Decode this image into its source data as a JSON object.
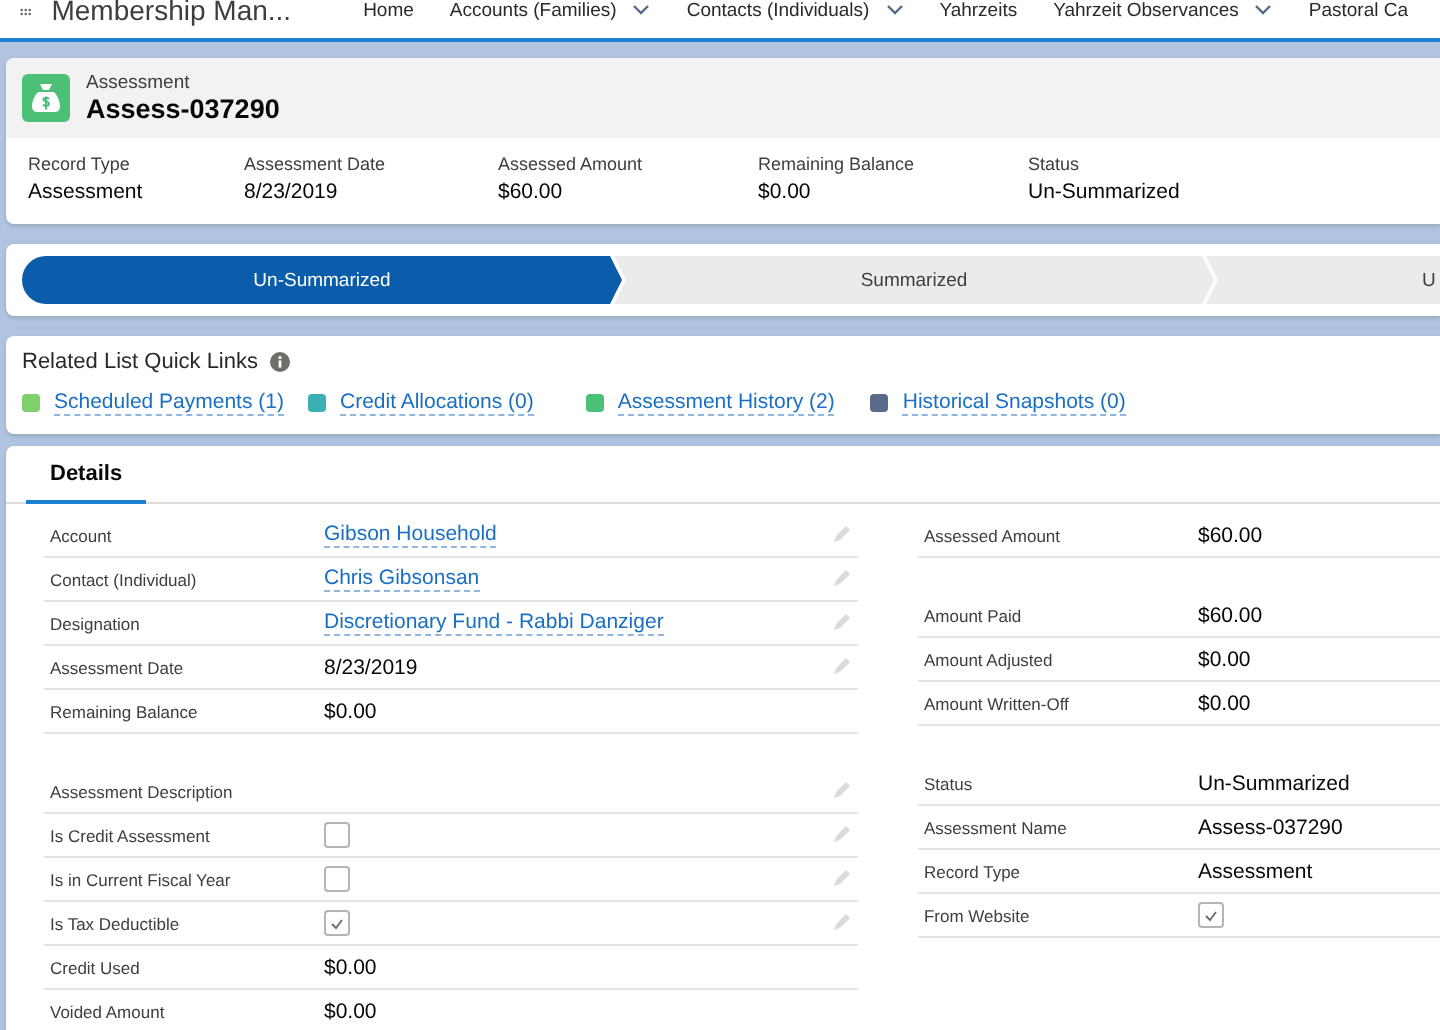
{
  "nav": {
    "app_name": "Membership Man...",
    "items": [
      {
        "label": "Home",
        "dropdown": false
      },
      {
        "label": "Accounts (Families)",
        "dropdown": true
      },
      {
        "label": "Contacts (Individuals)",
        "dropdown": true
      },
      {
        "label": "Yahrzeits",
        "dropdown": false
      },
      {
        "label": "Yahrzeit Observances",
        "dropdown": true
      },
      {
        "label": "Pastoral Ca",
        "dropdown": false
      }
    ]
  },
  "record_header": {
    "object_label": "Assessment",
    "title": "Assess-037290",
    "fields": [
      {
        "label": "Record Type",
        "value": "Assessment"
      },
      {
        "label": "Assessment Date",
        "value": "8/23/2019"
      },
      {
        "label": "Assessed Amount",
        "value": "$60.00"
      },
      {
        "label": "Remaining Balance",
        "value": "$0.00"
      },
      {
        "label": "Status",
        "value": "Un-Summarized"
      }
    ]
  },
  "path": [
    {
      "label": "Un-Summarized",
      "selected": true
    },
    {
      "label": "Summarized",
      "selected": false
    },
    {
      "label": "U",
      "selected": false
    }
  ],
  "quick_links": {
    "title": "Related List Quick Links",
    "links": [
      {
        "label": "Scheduled Payments (1)",
        "color": "#7fcf6a"
      },
      {
        "label": "Credit Allocations (0)",
        "color": "#3bb0b4"
      },
      {
        "label": "Assessment History (2)",
        "color": "#4bc076"
      },
      {
        "label": "Historical Snapshots (0)",
        "color": "#5a6a8a"
      }
    ]
  },
  "tabs": [
    {
      "label": "Details",
      "selected": true
    }
  ],
  "details": {
    "left": [
      [
        {
          "label": "Account",
          "kind": "link",
          "value": "Gibson Household",
          "editable": true
        },
        {
          "label": "Contact (Individual)",
          "kind": "link",
          "value": "Chris Gibsonsan",
          "editable": true
        },
        {
          "label": "Designation",
          "kind": "link",
          "value": "Discretionary Fund - Rabbi Danziger",
          "editable": true
        },
        {
          "label": "Assessment Date",
          "kind": "text",
          "value": "8/23/2019",
          "editable": true
        },
        {
          "label": "Remaining Balance",
          "kind": "text",
          "value": "$0.00",
          "editable": false
        }
      ],
      [
        {
          "label": "Assessment Description",
          "kind": "text",
          "editable": true
        },
        {
          "label": "Is Credit Assessment",
          "kind": "checkbox",
          "checked": false,
          "editable": true
        },
        {
          "label": "Is in Current Fiscal Year",
          "kind": "checkbox",
          "checked": false,
          "editable": true
        },
        {
          "label": "Is Tax Deductible",
          "kind": "checkbox",
          "checked": true,
          "editable": true
        },
        {
          "label": "Credit Used",
          "kind": "text",
          "value": "$0.00",
          "editable": false
        },
        {
          "label": "Voided Amount",
          "kind": "text",
          "value": "$0.00",
          "editable": false
        }
      ]
    ],
    "right": [
      [
        {
          "label": "Assessed Amount",
          "kind": "text",
          "value": "$60.00",
          "editable": false
        }
      ],
      [
        {
          "label": "Amount Paid",
          "kind": "text",
          "value": "$60.00",
          "editable": false
        },
        {
          "label": "Amount Adjusted",
          "kind": "text",
          "value": "$0.00",
          "editable": false
        },
        {
          "label": "Amount Written-Off",
          "kind": "text",
          "value": "$0.00",
          "editable": false
        }
      ],
      [
        {
          "label": "Status",
          "kind": "text",
          "value": "Un-Summarized",
          "editable": false
        },
        {
          "label": "Assessment Name",
          "kind": "text",
          "value": "Assess-037290",
          "editable": false
        },
        {
          "label": "Record Type",
          "kind": "text",
          "value": "Assessment",
          "editable": false
        },
        {
          "label": "From Website",
          "kind": "checkbox",
          "checked": true,
          "editable": false
        }
      ]
    ]
  }
}
